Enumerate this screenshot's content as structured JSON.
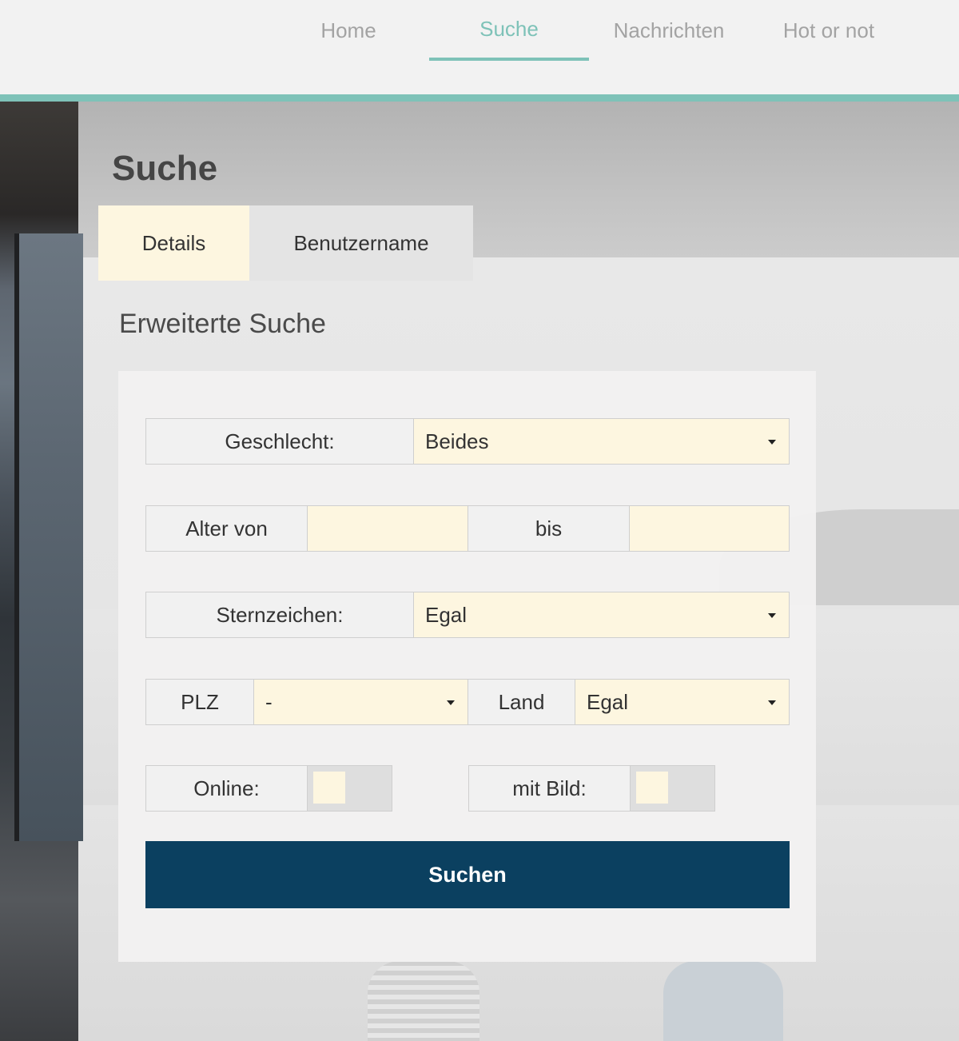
{
  "nav": {
    "items": [
      {
        "label": "Home"
      },
      {
        "label": "Suche",
        "active": true
      },
      {
        "label": "Nachrichten"
      },
      {
        "label": "Hot or not"
      }
    ],
    "active_color": "#7ec2b8",
    "inactive_color": "#a3a3a3"
  },
  "page_title": "Suche",
  "tabs": [
    {
      "label": "Details",
      "active": true
    },
    {
      "label": "Benutzername"
    }
  ],
  "section_title": "Erweiterte Suche",
  "form": {
    "gender": {
      "label": "Geschlecht:",
      "value": "Beides"
    },
    "age": {
      "from_label": "Alter von",
      "from_value": "",
      "to_label": "bis",
      "to_value": ""
    },
    "zodiac": {
      "label": "Sternzeichen:",
      "value": "Egal"
    },
    "zip": {
      "label": "PLZ",
      "value": "-"
    },
    "country": {
      "label": "Land",
      "value": "Egal"
    },
    "online": {
      "label": "Online:",
      "checked": false
    },
    "with_picture": {
      "label": "mit Bild:",
      "checked": false
    },
    "submit_label": "Suchen"
  },
  "colors": {
    "accent": "#7ec2b8",
    "input_bg": "#fdf6e0",
    "button_bg": "#0b4060"
  }
}
